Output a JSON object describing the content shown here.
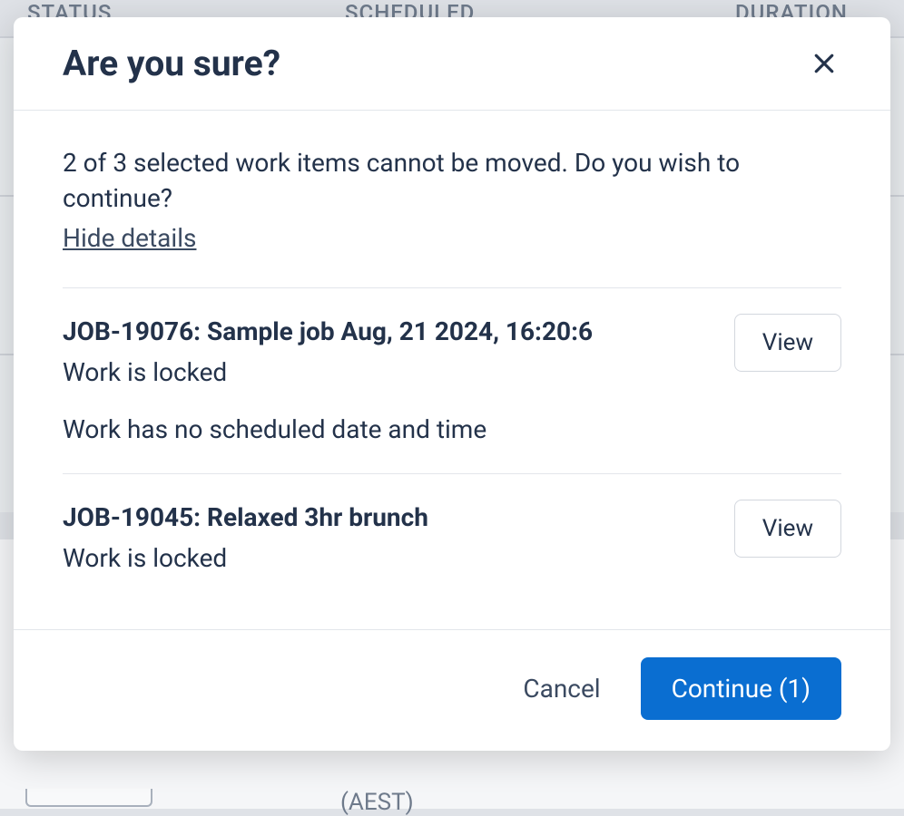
{
  "background": {
    "col_status": "STATUS",
    "col_scheduled": "SCHEDULED",
    "col_duration": "DURATION",
    "tz": "(AEST)"
  },
  "modal": {
    "title": "Are you sure?",
    "summary": "2 of 3 selected work items cannot be moved. Do you wish to continue?",
    "hide_details": "Hide details",
    "items": [
      {
        "title": "JOB-19076: Sample job Aug, 21 2024, 16:20:6",
        "reason": "Work is locked",
        "extra": "Work has no scheduled date and time",
        "view_label": "View"
      },
      {
        "title": "JOB-19045: Relaxed 3hr brunch",
        "reason": "Work is locked",
        "extra": "",
        "view_label": "View"
      }
    ],
    "footer": {
      "cancel": "Cancel",
      "continue": "Continue (1)"
    }
  }
}
